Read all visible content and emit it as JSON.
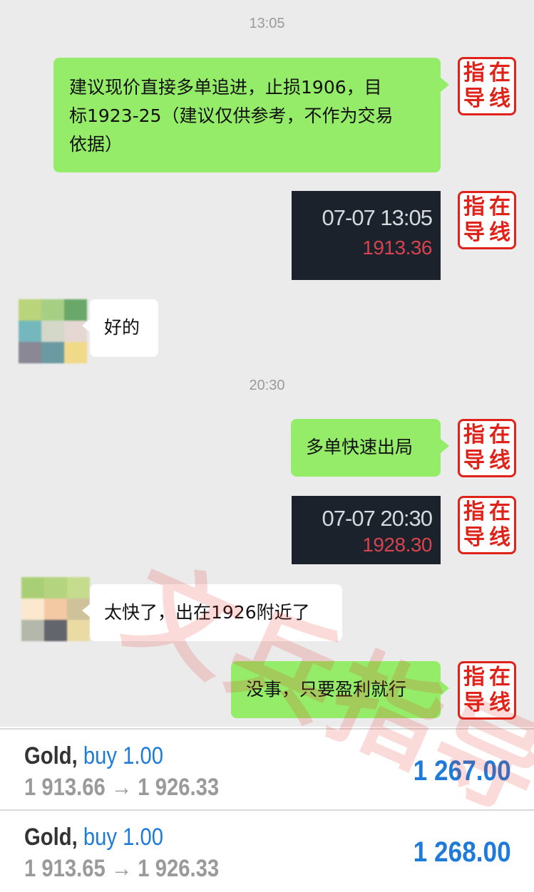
{
  "chat": {
    "timestamps": [
      "13:05",
      "20:30"
    ],
    "seal_chars": [
      "指",
      "在",
      "导",
      "线"
    ],
    "messages": {
      "advice": "建议现价直接多单追进，止损1906，目标1923-25（建议仅供参考，不作为交易依据）",
      "advice_lines": [
        "建议现价直接多单追进，止损1906，目",
        "标1923-25（建议仅供参考，不作为交易",
        "依据）"
      ],
      "reply_ok": "好的",
      "exit_call": "多单快速出局",
      "reply_fast": "太快了，出在1926附近了",
      "reply_profit": "没事，只要盈利就行"
    },
    "quotes": [
      {
        "time": "07-07 13:05",
        "price": "1913.36"
      },
      {
        "time": "07-07 20:30",
        "price": "1928.30"
      }
    ],
    "watermark": "文兵指导"
  },
  "orders": [
    {
      "symbol": "Gold,",
      "side": "buy 1.00",
      "prices": "1 913.66 → 1 926.33",
      "profit": "1 267.00"
    },
    {
      "symbol": "Gold,",
      "side": "buy 1.00",
      "prices": "1 913.65 → 1 926.33",
      "profit": "1 268.00"
    }
  ],
  "colors": {
    "bubble_out": "#95ec69",
    "bubble_in": "#ffffff",
    "seal_red": "#e0231a",
    "quote_bg": "#1b222c",
    "quote_price": "#d6434f",
    "profit_blue": "#1e7bd9"
  }
}
